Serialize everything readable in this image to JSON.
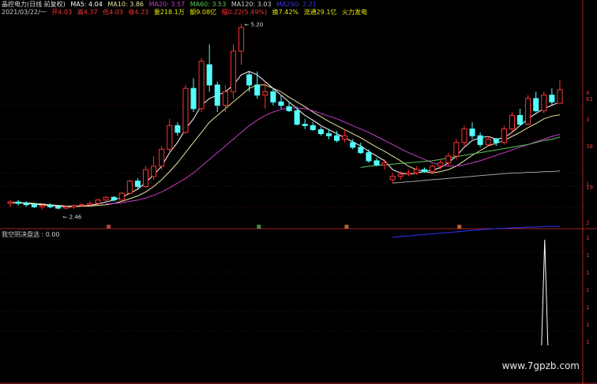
{
  "header": {
    "title": "晶控电力(日线 前复权)",
    "ma5": "MA5: 4.04",
    "ma10": "MA10: 3.86",
    "ma20": "MA20: 3.57",
    "ma60": "MA60: 3.53",
    "ma120": "MA120: 3.03",
    "ma250": "MA250: 2.21"
  },
  "info": {
    "date": "2021/03/22/一",
    "open": "开4.03",
    "high": "高4.37",
    "low": "低4.03",
    "close": "收4.23",
    "volume": "量218.1万",
    "amount": "额9.08亿",
    "change": "幅0.22(5.49%)",
    "turnover": "换7.42%",
    "float": "流通29.1亿",
    "concept": "火力发电"
  },
  "annotations": {
    "peak": "5.20",
    "low": "2.46"
  },
  "indicator": {
    "title": "我空阴决盘选 : 0.00"
  },
  "right_axis_labels": [
    "4",
    "61",
    "3",
    "38",
    "1",
    "19",
    "2"
  ],
  "watermark": "www.7gpzb.com",
  "colors": {
    "up": "#ff3232",
    "down": "#54ffff",
    "ma5": "#ffffff",
    "ma10": "#e6e6a0",
    "ma20": "#c83cc8",
    "ma60": "#5ac85a",
    "ma120": "#a0a0a0",
    "ma250": "#3232ff"
  },
  "chart_data": {
    "type": "candlestick",
    "price_range": [
      2.2,
      5.3
    ],
    "candles": [
      [
        2.55,
        2.6,
        2.5,
        2.57
      ],
      [
        2.57,
        2.6,
        2.52,
        2.55
      ],
      [
        2.55,
        2.58,
        2.5,
        2.53
      ],
      [
        2.53,
        2.56,
        2.48,
        2.5
      ],
      [
        2.5,
        2.53,
        2.46,
        2.52
      ],
      [
        2.52,
        2.55,
        2.48,
        2.5
      ],
      [
        2.5,
        2.52,
        2.46,
        2.48
      ],
      [
        2.48,
        2.5,
        2.46,
        2.5
      ],
      [
        2.5,
        2.53,
        2.47,
        2.52
      ],
      [
        2.52,
        2.55,
        2.5,
        2.53
      ],
      [
        2.53,
        2.58,
        2.5,
        2.55
      ],
      [
        2.55,
        2.62,
        2.52,
        2.6
      ],
      [
        2.6,
        2.66,
        2.58,
        2.64
      ],
      [
        2.64,
        2.66,
        2.58,
        2.6
      ],
      [
        2.6,
        2.72,
        2.58,
        2.7
      ],
      [
        2.7,
        2.9,
        2.68,
        2.88
      ],
      [
        2.88,
        2.92,
        2.76,
        2.8
      ],
      [
        2.8,
        3.1,
        2.78,
        3.05
      ],
      [
        2.95,
        3.25,
        2.9,
        3.1
      ],
      [
        3.1,
        3.4,
        3.05,
        3.35
      ],
      [
        3.35,
        3.8,
        3.3,
        3.7
      ],
      [
        3.7,
        3.75,
        3.55,
        3.6
      ],
      [
        3.6,
        4.3,
        3.58,
        4.25
      ],
      [
        4.25,
        4.4,
        3.9,
        3.95
      ],
      [
        3.95,
        4.7,
        3.9,
        4.65
      ],
      [
        4.6,
        4.9,
        4.2,
        4.3
      ],
      [
        4.3,
        4.35,
        3.9,
        4.0
      ],
      [
        4.0,
        4.3,
        3.9,
        4.2
      ],
      [
        4.2,
        4.9,
        4.1,
        4.8
      ],
      [
        4.8,
        5.2,
        4.6,
        5.15
      ],
      [
        4.45,
        4.5,
        4.2,
        4.3
      ],
      [
        4.3,
        4.5,
        4.1,
        4.15
      ],
      [
        4.15,
        4.35,
        3.95,
        4.2
      ],
      [
        4.2,
        4.25,
        4.0,
        4.05
      ],
      [
        4.05,
        4.15,
        3.95,
        4.0
      ],
      [
        3.98,
        4.05,
        3.9,
        3.92
      ],
      [
        3.92,
        3.98,
        3.7,
        3.72
      ],
      [
        3.72,
        3.8,
        3.65,
        3.7
      ],
      [
        3.7,
        3.75,
        3.62,
        3.64
      ],
      [
        3.64,
        3.68,
        3.55,
        3.58
      ],
      [
        3.58,
        3.65,
        3.5,
        3.55
      ],
      [
        3.55,
        3.62,
        3.45,
        3.48
      ],
      [
        3.5,
        3.65,
        3.45,
        3.55
      ],
      [
        3.45,
        3.5,
        3.35,
        3.38
      ],
      [
        3.38,
        3.45,
        3.28,
        3.3
      ],
      [
        3.3,
        3.35,
        3.15,
        3.18
      ],
      [
        3.18,
        3.22,
        3.1,
        3.12
      ],
      [
        3.12,
        3.2,
        3.05,
        3.15
      ],
      [
        2.9,
        3.0,
        2.85,
        2.95
      ],
      [
        2.95,
        3.02,
        2.9,
        2.98
      ],
      [
        2.98,
        3.05,
        2.95,
        3.0
      ],
      [
        3.0,
        3.1,
        2.97,
        3.05
      ],
      [
        3.05,
        3.08,
        3.0,
        3.02
      ],
      [
        3.02,
        3.12,
        3.0,
        3.1
      ],
      [
        3.1,
        3.2,
        3.05,
        3.15
      ],
      [
        3.15,
        3.3,
        3.1,
        3.25
      ],
      [
        3.25,
        3.5,
        3.2,
        3.45
      ],
      [
        3.45,
        3.7,
        3.4,
        3.65
      ],
      [
        3.65,
        3.75,
        3.5,
        3.55
      ],
      [
        3.55,
        3.6,
        3.38,
        3.42
      ],
      [
        3.42,
        3.55,
        3.4,
        3.5
      ],
      [
        3.5,
        3.52,
        3.4,
        3.45
      ],
      [
        3.45,
        3.7,
        3.42,
        3.65
      ],
      [
        3.65,
        3.9,
        3.6,
        3.85
      ],
      [
        3.85,
        3.95,
        3.7,
        3.72
      ],
      [
        3.72,
        4.15,
        3.7,
        4.1
      ],
      [
        4.1,
        4.2,
        3.9,
        3.92
      ],
      [
        3.92,
        4.2,
        3.88,
        4.15
      ],
      [
        4.15,
        4.25,
        4.0,
        4.05
      ],
      [
        4.03,
        4.37,
        4.03,
        4.23
      ]
    ],
    "ma": [
      {
        "name": "MA5",
        "color": "#ffffff",
        "values": [
          2.56,
          2.56,
          2.55,
          2.54,
          2.53,
          2.52,
          2.51,
          2.5,
          2.5,
          2.51,
          2.52,
          2.54,
          2.57,
          2.6,
          2.64,
          2.7,
          2.76,
          2.86,
          2.97,
          3.1,
          3.3,
          3.45,
          3.65,
          3.8,
          4.0,
          4.1,
          4.15,
          4.2,
          4.3,
          4.45,
          4.5,
          4.45,
          4.35,
          4.25,
          4.15,
          4.05,
          3.95,
          3.85,
          3.78,
          3.7,
          3.64,
          3.58,
          3.52,
          3.46,
          3.4,
          3.32,
          3.25,
          3.18,
          3.05,
          3.0,
          2.98,
          3.0,
          3.02,
          3.04,
          3.08,
          3.15,
          3.25,
          3.38,
          3.48,
          3.52,
          3.54,
          3.5,
          3.52,
          3.6,
          3.7,
          3.8,
          3.88,
          3.95,
          4.0,
          4.05
        ]
      },
      {
        "name": "MA10",
        "color": "#e6e6a0",
        "values": [
          2.57,
          2.56,
          2.56,
          2.55,
          2.54,
          2.53,
          2.52,
          2.51,
          2.51,
          2.51,
          2.51,
          2.52,
          2.53,
          2.55,
          2.58,
          2.62,
          2.66,
          2.72,
          2.8,
          2.9,
          3.02,
          3.15,
          3.3,
          3.45,
          3.6,
          3.75,
          3.85,
          3.95,
          4.05,
          4.15,
          4.25,
          4.3,
          4.3,
          4.25,
          4.2,
          4.12,
          4.05,
          3.98,
          3.9,
          3.83,
          3.76,
          3.7,
          3.64,
          3.58,
          3.52,
          3.45,
          3.38,
          3.32,
          3.25,
          3.18,
          3.1,
          3.05,
          3.02,
          3.0,
          3.02,
          3.05,
          3.1,
          3.18,
          3.26,
          3.33,
          3.4,
          3.44,
          3.48,
          3.54,
          3.6,
          3.67,
          3.73,
          3.8,
          3.84,
          3.86
        ]
      },
      {
        "name": "MA20",
        "color": "#c83cc8",
        "values": [
          null,
          null,
          null,
          null,
          null,
          null,
          null,
          null,
          null,
          null,
          null,
          null,
          2.54,
          2.55,
          2.56,
          2.58,
          2.6,
          2.63,
          2.67,
          2.72,
          2.78,
          2.85,
          2.92,
          3.0,
          3.1,
          3.2,
          3.3,
          3.4,
          3.5,
          3.6,
          3.7,
          3.78,
          3.85,
          3.9,
          3.94,
          3.96,
          3.96,
          3.95,
          3.92,
          3.88,
          3.84,
          3.8,
          3.75,
          3.7,
          3.65,
          3.6,
          3.54,
          3.48,
          3.42,
          3.36,
          3.3,
          3.25,
          3.2,
          3.15,
          3.12,
          3.1,
          3.1,
          3.12,
          3.15,
          3.18,
          3.22,
          3.26,
          3.3,
          3.34,
          3.38,
          3.42,
          3.46,
          3.5,
          3.54,
          3.57
        ]
      },
      {
        "name": "MA60",
        "color": "#5ac85a",
        "values": [
          null,
          null,
          null,
          null,
          null,
          null,
          null,
          null,
          null,
          null,
          null,
          null,
          null,
          null,
          null,
          null,
          null,
          null,
          null,
          null,
          null,
          null,
          null,
          null,
          null,
          null,
          null,
          null,
          null,
          null,
          null,
          null,
          null,
          null,
          null,
          null,
          null,
          null,
          null,
          null,
          null,
          null,
          null,
          null,
          3.08,
          3.1,
          3.11,
          3.12,
          3.13,
          3.14,
          3.15,
          3.16,
          3.17,
          3.18,
          3.2,
          3.22,
          3.24,
          3.26,
          3.28,
          3.3,
          3.32,
          3.34,
          3.36,
          3.38,
          3.4,
          3.42,
          3.45,
          3.48,
          3.5,
          3.53
        ]
      },
      {
        "name": "MA120",
        "color": "#a0a0a0",
        "values": [
          null,
          null,
          null,
          null,
          null,
          null,
          null,
          null,
          null,
          null,
          null,
          null,
          null,
          null,
          null,
          null,
          null,
          null,
          null,
          null,
          null,
          null,
          null,
          null,
          null,
          null,
          null,
          null,
          null,
          null,
          null,
          null,
          null,
          null,
          null,
          null,
          null,
          null,
          null,
          null,
          null,
          null,
          null,
          null,
          null,
          null,
          null,
          null,
          2.85,
          2.86,
          2.87,
          2.88,
          2.89,
          2.9,
          2.91,
          2.92,
          2.93,
          2.94,
          2.95,
          2.96,
          2.97,
          2.98,
          2.99,
          3.0,
          3.0,
          3.01,
          3.01,
          3.02,
          3.02,
          3.03
        ]
      },
      {
        "name": "MA250",
        "color": "#3232ff",
        "values": [
          null,
          null,
          null,
          null,
          null,
          null,
          null,
          null,
          null,
          null,
          null,
          null,
          null,
          null,
          null,
          null,
          null,
          null,
          null,
          null,
          null,
          null,
          null,
          null,
          null,
          null,
          null,
          null,
          null,
          null,
          null,
          null,
          null,
          null,
          null,
          null,
          null,
          null,
          null,
          null,
          null,
          null,
          null,
          null,
          null,
          null,
          null,
          null,
          2.05,
          2.06,
          2.07,
          2.08,
          2.09,
          2.1,
          2.11,
          2.12,
          2.13,
          2.14,
          2.15,
          2.16,
          2.17,
          2.18,
          2.18,
          2.19,
          2.19,
          2.2,
          2.2,
          2.21,
          2.21,
          2.21
        ]
      }
    ],
    "indicator_series": {
      "name": "我空阴决盘选",
      "range": [
        0,
        1
      ],
      "signal_index": 67,
      "signal_value": 1
    }
  }
}
